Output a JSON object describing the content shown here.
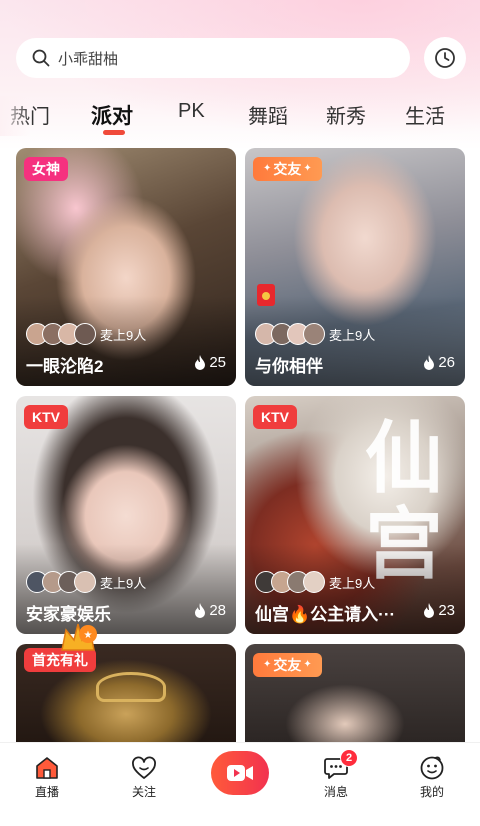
{
  "search": {
    "placeholder": "小乖甜柚"
  },
  "tabs": [
    {
      "label": "热门"
    },
    {
      "label": "派对",
      "active": true
    },
    {
      "label": "PK"
    },
    {
      "label": "舞蹈"
    },
    {
      "label": "新秀"
    },
    {
      "label": "生活"
    }
  ],
  "cards": [
    {
      "badge": "女神",
      "mic": "麦上9人",
      "title": "一眼沦陷2",
      "heat": "25"
    },
    {
      "badge": "交友",
      "mic": "麦上9人",
      "title": "与你相伴",
      "heat": "26"
    },
    {
      "badge": "KTV",
      "mic": "麦上9人",
      "title": "安家豪娱乐",
      "heat": "28"
    },
    {
      "badge": "KTV",
      "mic": "麦上9人",
      "title": "仙宫🔥公主请入···",
      "heat": "23"
    },
    {
      "badge": "首充有礼"
    },
    {
      "badge": "交友"
    }
  ],
  "nav": {
    "live": "直播",
    "follow": "关注",
    "messages": "消息",
    "messages_badge": "2",
    "me": "我的"
  },
  "colors": {
    "accent": "#f04a3a",
    "badge_pink": "#f5317f",
    "badge_orange": "#ff7a3c",
    "badge_red": "#f03d3d"
  }
}
